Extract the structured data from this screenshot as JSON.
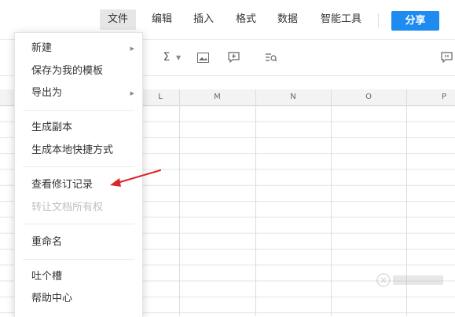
{
  "menubar": {
    "items": [
      {
        "label": "文件",
        "active": true
      },
      {
        "label": "编辑"
      },
      {
        "label": "插入"
      },
      {
        "label": "格式"
      },
      {
        "label": "数据"
      },
      {
        "label": "智能工具"
      }
    ],
    "share_label": "分享",
    "accent_color": "#1e8bf0"
  },
  "toolbar": {
    "icons": [
      "sum-icon",
      "image-icon",
      "comment-add-icon",
      "find-icon",
      "comment-icon"
    ],
    "sum_glyph": "Σ"
  },
  "grid": {
    "columns": [
      "L",
      "M",
      "N",
      "O",
      "P"
    ]
  },
  "file_menu": {
    "items": [
      {
        "label": "新建",
        "submenu": true
      },
      {
        "label": "保存为我的模板"
      },
      {
        "label": "导出为",
        "submenu": true
      },
      {
        "label": "生成副本"
      },
      {
        "label": "生成本地快捷方式"
      },
      {
        "label": "查看修订记录"
      },
      {
        "label": "转让文档所有权",
        "disabled": true
      },
      {
        "label": "重命名"
      },
      {
        "label": "吐个槽"
      },
      {
        "label": "帮助中心"
      }
    ]
  },
  "annotation": {
    "color": "#d9262b"
  }
}
